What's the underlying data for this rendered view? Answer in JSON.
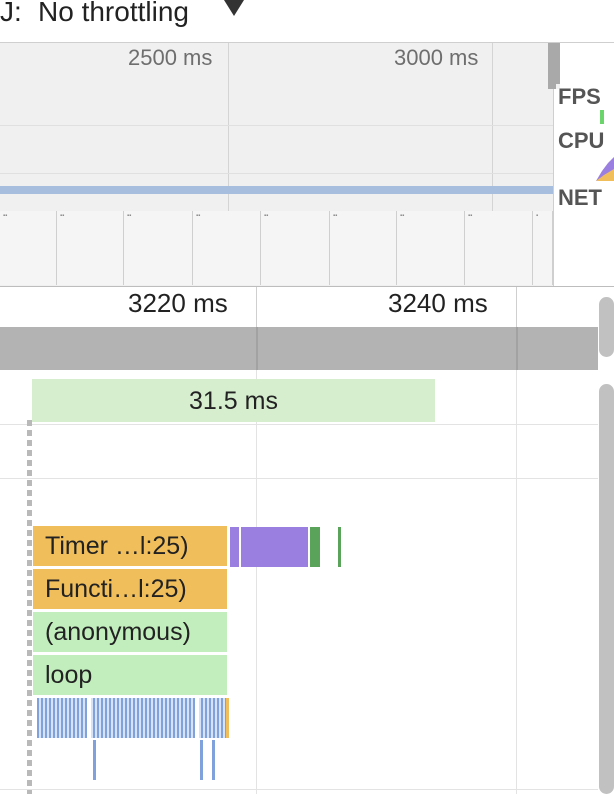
{
  "throttling": {
    "prefix": "J:",
    "label": "No throttling",
    "arrow_icon": "triangle-down-icon"
  },
  "overview": {
    "ruler_labels": [
      "2500 ms",
      "3000 ms"
    ],
    "track_labels": {
      "fps": "FPS",
      "cpu": "CPU",
      "net": "NET"
    },
    "colors": {
      "net_band": "#a7bede",
      "fps": "#6bd46b"
    }
  },
  "detail": {
    "ruler_labels": [
      "3220 ms",
      "3240 ms"
    ],
    "frame_duration": "31.5 ms",
    "flame_rows": [
      {
        "label": "Timer …l:25)",
        "color": "#f0be5b"
      },
      {
        "label": "Functi…l:25)",
        "color": "#f0be5b"
      },
      {
        "label": "(anonymous)",
        "color": "#c1eebc"
      },
      {
        "label": "loop",
        "color": "#c1eebc"
      }
    ],
    "colors": {
      "scripting": "#f0be5b",
      "rendering": "#9b7fe0",
      "painting": "#5aa35a",
      "frame": "#d6eece",
      "loading": "#7fa2dc"
    }
  }
}
